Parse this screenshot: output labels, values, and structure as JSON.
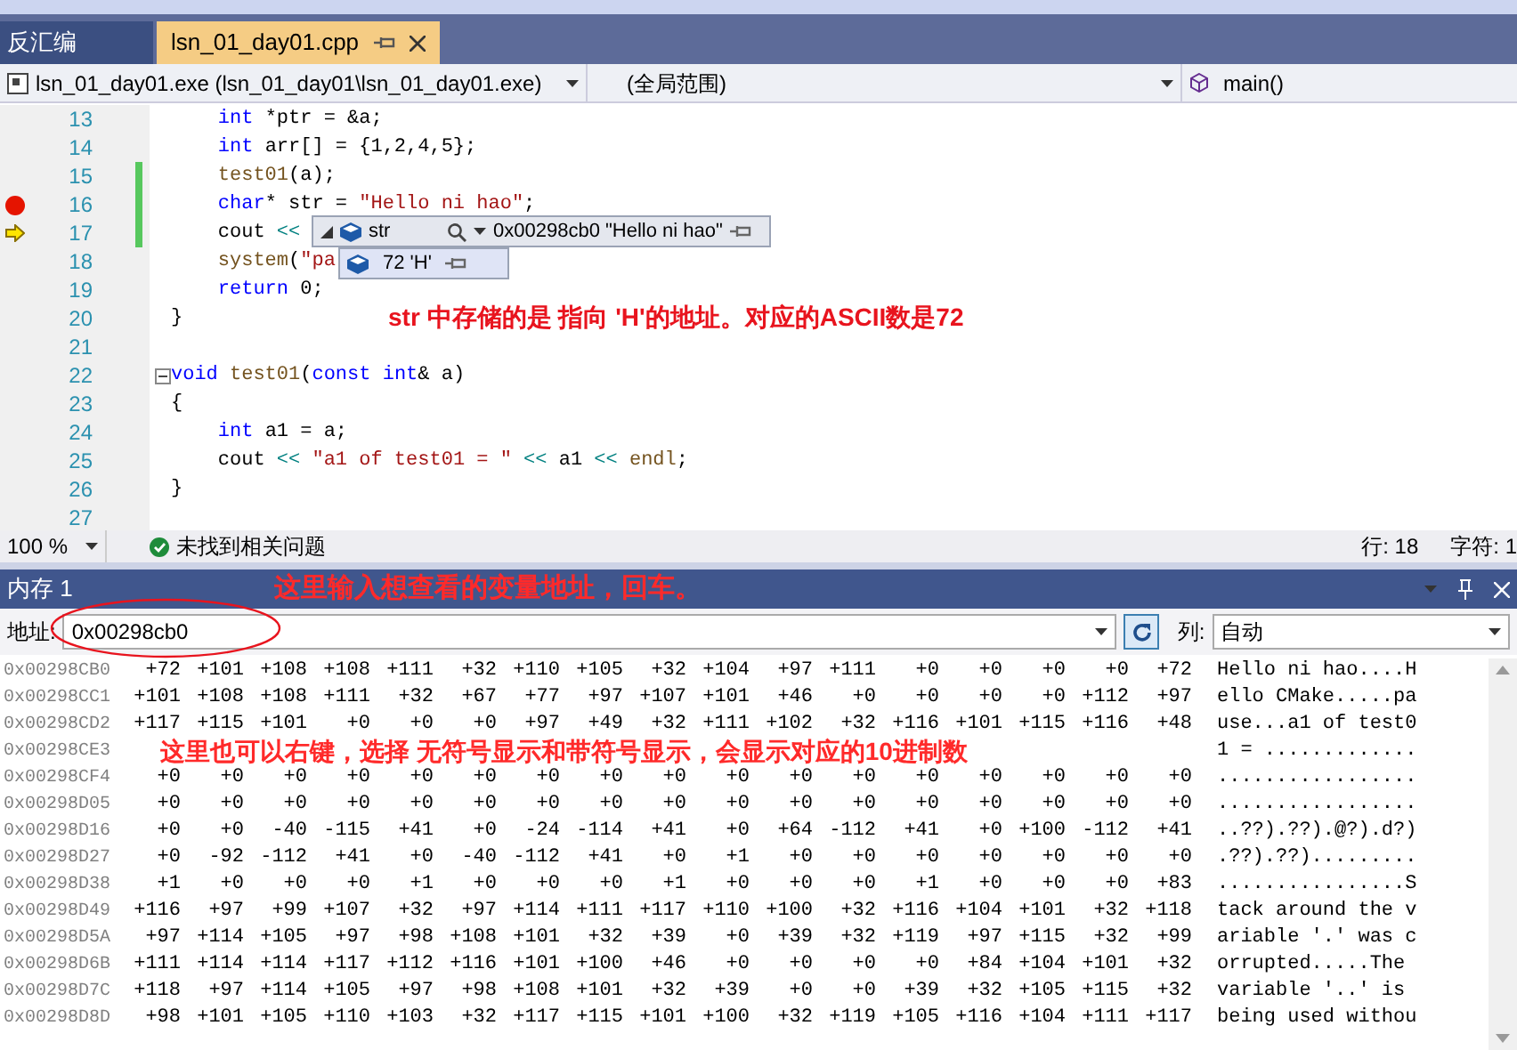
{
  "tabs": [
    {
      "label": "反汇编",
      "selected": false
    },
    {
      "label": "lsn_01_day01.cpp",
      "selected": true
    }
  ],
  "nav": {
    "project": "lsn_01_day01.exe (lsn_01_day01\\lsn_01_day01.exe)",
    "scope": "(全局范围)",
    "member": "main()"
  },
  "code": {
    "lines": [
      {
        "number": "13",
        "breakpoint": false,
        "current": false,
        "changed": false,
        "collapsible": false,
        "tokens": [
          {
            "kind": "kw",
            "text": "    int"
          },
          {
            "kind": "plain",
            "text": " *ptr = &a;"
          }
        ]
      },
      {
        "number": "14",
        "breakpoint": false,
        "current": false,
        "changed": false,
        "collapsible": false,
        "tokens": [
          {
            "kind": "kw",
            "text": "    int"
          },
          {
            "kind": "plain",
            "text": " arr[] = {1,2,4,5};"
          }
        ]
      },
      {
        "number": "15",
        "breakpoint": false,
        "current": false,
        "changed": true,
        "collapsible": false,
        "tokens": [
          {
            "kind": "fn",
            "text": "    test01"
          },
          {
            "kind": "plain",
            "text": "(a);"
          }
        ]
      },
      {
        "number": "16",
        "breakpoint": true,
        "current": false,
        "changed": true,
        "collapsible": false,
        "tokens": [
          {
            "kind": "kw",
            "text": "    char"
          },
          {
            "kind": "plain",
            "text": "* str = "
          },
          {
            "kind": "str",
            "text": "\"Hello ni hao\""
          },
          {
            "kind": "plain",
            "text": ";"
          }
        ]
      },
      {
        "number": "17",
        "breakpoint": false,
        "current": true,
        "changed": true,
        "collapsible": false,
        "tokens": [
          {
            "kind": "plain",
            "text": "    cout "
          },
          {
            "kind": "op",
            "text": "<<"
          }
        ]
      },
      {
        "number": "18",
        "breakpoint": false,
        "current": false,
        "changed": false,
        "collapsible": false,
        "tokens": [
          {
            "kind": "fn",
            "text": "    system"
          },
          {
            "kind": "plain",
            "text": "("
          },
          {
            "kind": "str",
            "text": "\"pa"
          }
        ]
      },
      {
        "number": "19",
        "breakpoint": false,
        "current": false,
        "changed": false,
        "collapsible": false,
        "tokens": [
          {
            "kind": "kw",
            "text": "    return"
          },
          {
            "kind": "plain",
            "text": " 0;"
          }
        ]
      },
      {
        "number": "20",
        "breakpoint": false,
        "current": false,
        "changed": false,
        "collapsible": false,
        "tokens": [
          {
            "kind": "plain",
            "text": "}"
          }
        ]
      },
      {
        "number": "21",
        "breakpoint": false,
        "current": false,
        "changed": false,
        "collapsible": false
      },
      {
        "number": "22",
        "breakpoint": false,
        "current": false,
        "changed": false,
        "collapsible": true,
        "tokens": [
          {
            "kind": "kw",
            "text": "void"
          },
          {
            "kind": "fn",
            "text": " test01"
          },
          {
            "kind": "plain",
            "text": "("
          },
          {
            "kind": "kw",
            "text": "const int"
          },
          {
            "kind": "plain",
            "text": "& a)"
          }
        ]
      },
      {
        "number": "23",
        "breakpoint": false,
        "current": false,
        "changed": false,
        "collapsible": false,
        "tokens": [
          {
            "kind": "plain",
            "text": "{"
          }
        ]
      },
      {
        "number": "24",
        "breakpoint": false,
        "current": false,
        "changed": false,
        "collapsible": false,
        "tokens": [
          {
            "kind": "kw",
            "text": "    int"
          },
          {
            "kind": "plain",
            "text": " a1 = a;"
          }
        ]
      },
      {
        "number": "25",
        "breakpoint": false,
        "current": false,
        "changed": false,
        "collapsible": false,
        "tokens": [
          {
            "kind": "plain",
            "text": "    cout "
          },
          {
            "kind": "op",
            "text": "<<"
          },
          {
            "kind": "str",
            "text": " \"a1 of test01 = \""
          },
          {
            "kind": "op",
            "text": " <<"
          },
          {
            "kind": "plain",
            "text": " a1 "
          },
          {
            "kind": "op",
            "text": "<<"
          },
          {
            "kind": "fn",
            "text": " endl"
          },
          {
            "kind": "plain",
            "text": ";"
          }
        ]
      },
      {
        "number": "26",
        "breakpoint": false,
        "current": false,
        "changed": false,
        "collapsible": false,
        "tokens": [
          {
            "kind": "plain",
            "text": "}"
          }
        ]
      },
      {
        "number": "27",
        "breakpoint": false,
        "current": false,
        "changed": false,
        "collapsible": false
      }
    ],
    "datatip": {
      "name": "str",
      "value": "0x00298cb0 \"Hello ni hao\"",
      "expanded": true,
      "children": [
        {
          "value": "72 'H'"
        }
      ]
    },
    "annotation": "str 中存储的是 指向 'H'的地址。对应的ASCII数是72"
  },
  "status": {
    "zoom": "100 %",
    "issues": "未找到相关问题",
    "line": "行: 18",
    "char": "字符: 1"
  },
  "memory": {
    "title": "内存 1",
    "title_annotation": "这里输入想查看的变量地址，回车。",
    "address_label": "地址:",
    "address": "0x00298cb0",
    "columns_label": "列:",
    "columns": "自动",
    "grid_annotation": "这里也可以右键，选择 无符号显示和带符号显示，会显示对应的10进制数",
    "rows": [
      {
        "address": "0x00298CB0",
        "values": [
          "+72",
          "+101",
          "+108",
          "+108",
          "+111",
          "+32",
          "+110",
          "+105",
          "+32",
          "+104",
          "+97",
          "+111",
          "+0",
          "+0",
          "+0",
          "+0",
          "+72"
        ],
        "text": "Hello ni hao....H"
      },
      {
        "address": "0x00298CC1",
        "values": [
          "+101",
          "+108",
          "+108",
          "+111",
          "+32",
          "+67",
          "+77",
          "+97",
          "+107",
          "+101",
          "+46",
          "+0",
          "+0",
          "+0",
          "+0",
          "+112",
          "+97"
        ],
        "text": "ello CMake.....pa"
      },
      {
        "address": "0x00298CD2",
        "values": [
          "+117",
          "+115",
          "+101",
          "+0",
          "+0",
          "+0",
          "+97",
          "+49",
          "+32",
          "+111",
          "+102",
          "+32",
          "+116",
          "+101",
          "+115",
          "+116",
          "+48"
        ],
        "text": "use...a1 of test0"
      },
      {
        "address": "0x00298CE3",
        "text": "1 = ............."
      },
      {
        "address": "0x00298CF4",
        "values": [
          "+0",
          "+0",
          "+0",
          "+0",
          "+0",
          "+0",
          "+0",
          "+0",
          "+0",
          "+0",
          "+0",
          "+0",
          "+0",
          "+0",
          "+0",
          "+0",
          "+0"
        ],
        "text": "................."
      },
      {
        "address": "0x00298D05",
        "values": [
          "+0",
          "+0",
          "+0",
          "+0",
          "+0",
          "+0",
          "+0",
          "+0",
          "+0",
          "+0",
          "+0",
          "+0",
          "+0",
          "+0",
          "+0",
          "+0",
          "+0"
        ],
        "text": "................."
      },
      {
        "address": "0x00298D16",
        "values": [
          "+0",
          "+0",
          "-40",
          "-115",
          "+41",
          "+0",
          "-24",
          "-114",
          "+41",
          "+0",
          "+64",
          "-112",
          "+41",
          "+0",
          "+100",
          "-112",
          "+41"
        ],
        "text": "..??).??).@?).d?)"
      },
      {
        "address": "0x00298D27",
        "values": [
          "+0",
          "-92",
          "-112",
          "+41",
          "+0",
          "-40",
          "-112",
          "+41",
          "+0",
          "+1",
          "+0",
          "+0",
          "+0",
          "+0",
          "+0",
          "+0",
          "+0"
        ],
        "text": ".??).??)........."
      },
      {
        "address": "0x00298D38",
        "values": [
          "+1",
          "+0",
          "+0",
          "+0",
          "+1",
          "+0",
          "+0",
          "+0",
          "+1",
          "+0",
          "+0",
          "+0",
          "+1",
          "+0",
          "+0",
          "+0",
          "+83"
        ],
        "text": "................S"
      },
      {
        "address": "0x00298D49",
        "values": [
          "+116",
          "+97",
          "+99",
          "+107",
          "+32",
          "+97",
          "+114",
          "+111",
          "+117",
          "+110",
          "+100",
          "+32",
          "+116",
          "+104",
          "+101",
          "+32",
          "+118"
        ],
        "text": "tack around the v"
      },
      {
        "address": "0x00298D5A",
        "values": [
          "+97",
          "+114",
          "+105",
          "+97",
          "+98",
          "+108",
          "+101",
          "+32",
          "+39",
          "+0",
          "+39",
          "+32",
          "+119",
          "+97",
          "+115",
          "+32",
          "+99"
        ],
        "text": "ariable '.' was c"
      },
      {
        "address": "0x00298D6B",
        "values": [
          "+111",
          "+114",
          "+114",
          "+117",
          "+112",
          "+116",
          "+101",
          "+100",
          "+46",
          "+0",
          "+0",
          "+0",
          "+0",
          "+84",
          "+104",
          "+101",
          "+32"
        ],
        "text": "orrupted.....The "
      },
      {
        "address": "0x00298D7C",
        "values": [
          "+118",
          "+97",
          "+114",
          "+105",
          "+97",
          "+98",
          "+108",
          "+101",
          "+32",
          "+39",
          "+0",
          "+0",
          "+39",
          "+32",
          "+105",
          "+115",
          "+32"
        ],
        "text": "variable '..' is "
      },
      {
        "address": "0x00298D8D",
        "values": [
          "+98",
          "+101",
          "+105",
          "+110",
          "+103",
          "+32",
          "+117",
          "+115",
          "+101",
          "+100",
          "+32",
          "+119",
          "+105",
          "+116",
          "+104",
          "+111",
          "+117"
        ],
        "text": "being used withou"
      }
    ]
  }
}
